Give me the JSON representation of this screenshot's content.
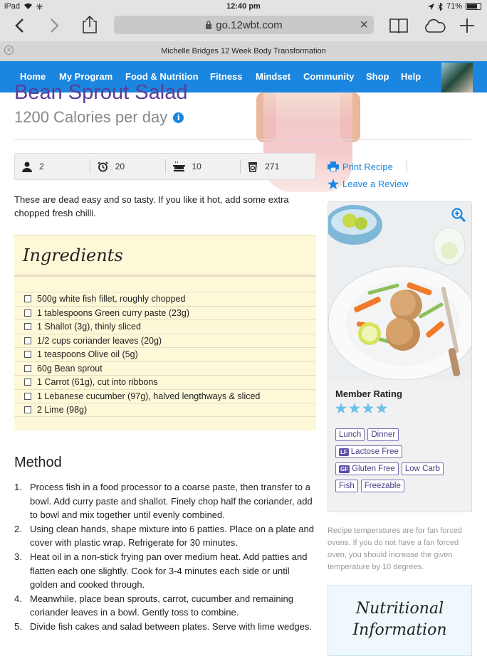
{
  "status_bar": {
    "carrier": "iPad",
    "time": "12:40 pm",
    "battery": "71%"
  },
  "browser": {
    "url": "go.12wbt.com",
    "tab_title": "Michelle Bridges 12 Week Body Transformation"
  },
  "nav": {
    "items": [
      "Home",
      "My Program",
      "Food & Nutrition",
      "Fitness",
      "Mindset",
      "Community",
      "Shop",
      "Help"
    ]
  },
  "recipe": {
    "title": "Bean Sprout Salad",
    "subtitle": "1200 Calories per day",
    "stats": {
      "serves": "2",
      "prep": "20",
      "cook": "10",
      "calories": "271"
    },
    "intro": "These are dead easy and so tasty. If you like it hot, add some extra chopped fresh chilli.",
    "ingredients_title": "Ingredients",
    "ingredients": [
      "500g white fish fillet, roughly chopped",
      "1 tablespoons Green curry paste (23g)",
      "1 Shallot (3g), thinly sliced",
      "1/2 cups coriander leaves (20g)",
      "1 teaspoons Olive oil (5g)",
      "60g Bean sprout",
      "1 Carrot (61g), cut into ribbons",
      "1 Lebanese cucumber (97g), halved lengthways & sliced",
      "2 Lime (98g)"
    ],
    "method_title": "Method",
    "method": [
      "Process fish in a food processor to a coarse paste, then transfer to a bowl. Add curry paste and shallot. Finely chop half the coriander, add to bowl and mix together until evenly combined.",
      "Using clean hands, shape mixture into 6 patties. Place on a plate and cover with plastic wrap. Refrigerate for 30 minutes.",
      "Heat oil in a non-stick frying pan over medium heat. Add patties and flatten each one slightly. Cook for 3-4 minutes each side or until golden and cooked through.",
      "Meanwhile, place bean sprouts, carrot, cucumber and remaining coriander leaves in a bowl. Gently toss to combine.",
      "Divide fish cakes and salad between plates. Serve with lime wedges."
    ]
  },
  "actions": {
    "print": "Print Recipe",
    "review": "Leave a Review"
  },
  "sidebar": {
    "rating_label": "Member Rating",
    "rating": 4,
    "tags": [
      {
        "label": "Lunch",
        "badge": ""
      },
      {
        "label": "Dinner",
        "badge": ""
      },
      {
        "label": "Lactose Free",
        "badge": "LF"
      },
      {
        "label": "Gluten Free",
        "badge": "GF"
      },
      {
        "label": "Low Carb",
        "badge": ""
      },
      {
        "label": "Fish",
        "badge": ""
      },
      {
        "label": "Freezable",
        "badge": ""
      }
    ],
    "temp_note": "Recipe temperatures are for fan forced ovens. If you do not have a fan forced oven, you should increase the given temperature by 10 degrees.",
    "nutrition_title": "Nutritional Information"
  },
  "colors": {
    "nav_blue": "#1a86e0",
    "title_purple": "#5b3e9a",
    "star_blue": "#6ec1ea",
    "tag_purple": "#5b4fa8"
  }
}
